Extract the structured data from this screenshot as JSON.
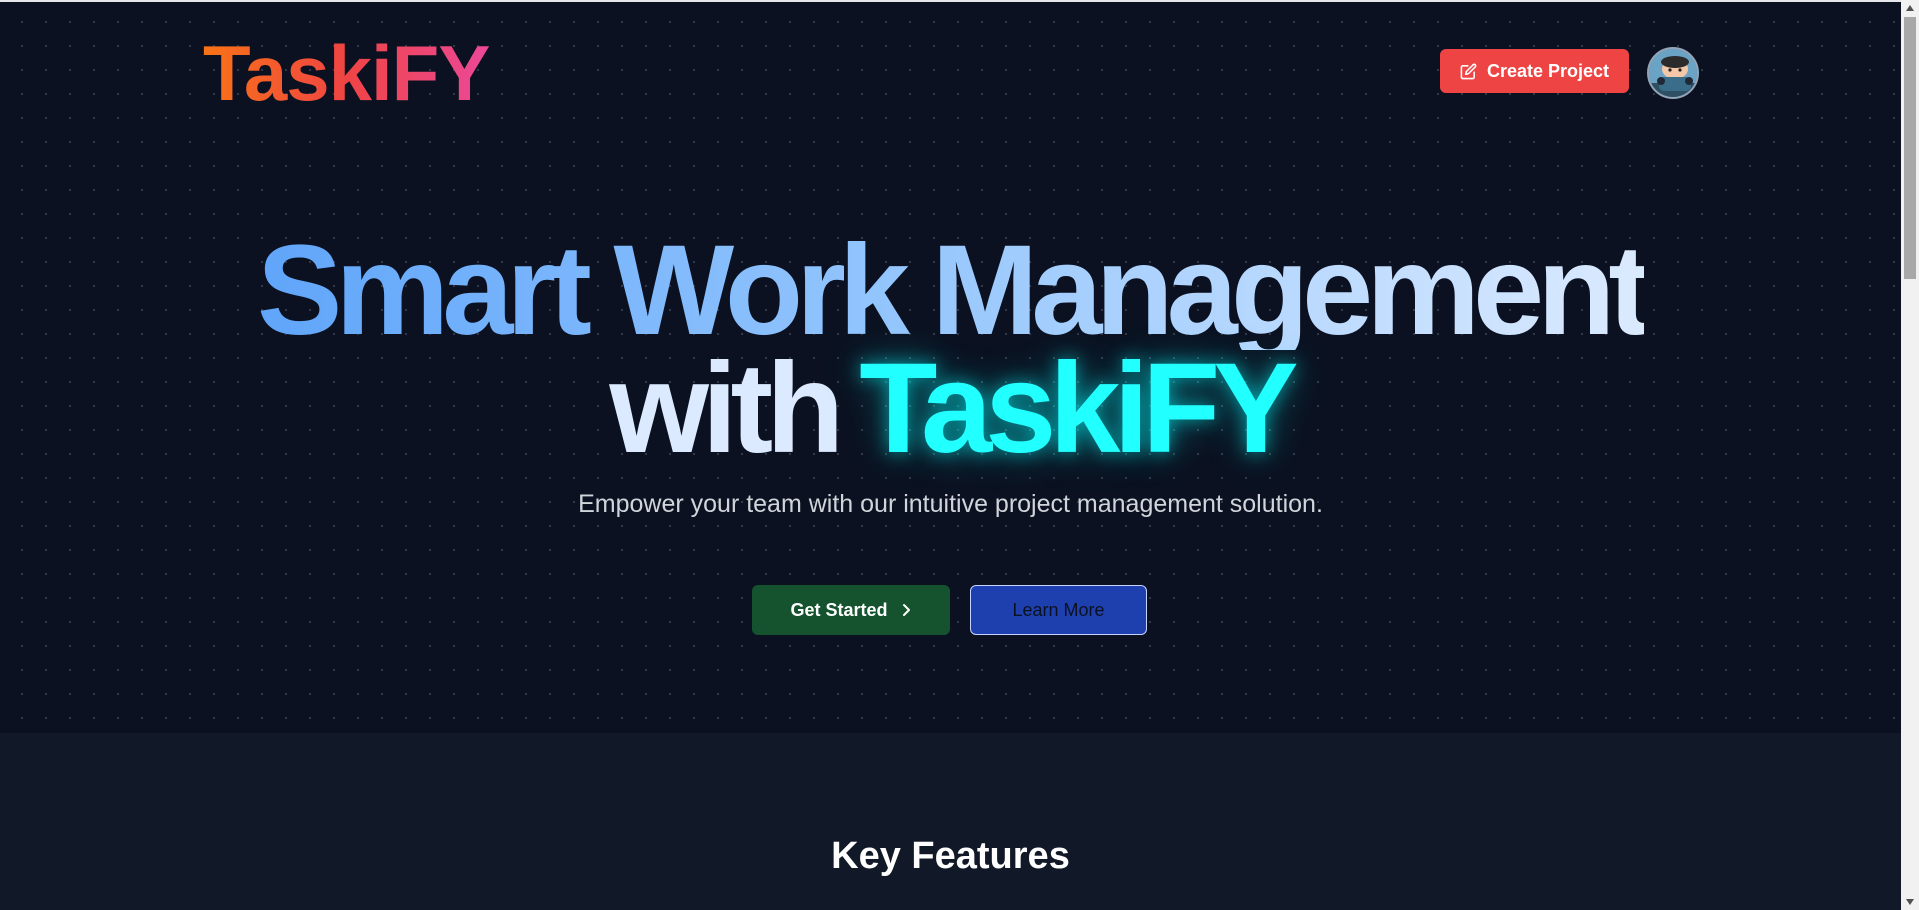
{
  "header": {
    "logo_text": "TaskiFY",
    "create_project_label": "Create Project",
    "icons": {
      "create": "edit-square-icon",
      "avatar": "user-avatar"
    }
  },
  "hero": {
    "headline_line1": "Smart Work Management",
    "headline_with": "with",
    "headline_brand": "TaskiFY",
    "tagline": "Empower your team with our intuitive project management solution.",
    "get_started_label": "Get Started",
    "learn_more_label": "Learn More"
  },
  "features": {
    "title": "Key Features"
  },
  "colors": {
    "background": "#0b1120",
    "section_background": "#111827",
    "create_button": "#ef4444",
    "get_started_button": "#14532d",
    "learn_more_button": "#1e40af",
    "brand_glow": "#22ffff"
  },
  "scrollbar": {
    "icons": [
      "scroll-up-arrow-icon",
      "scroll-down-arrow-icon"
    ]
  }
}
